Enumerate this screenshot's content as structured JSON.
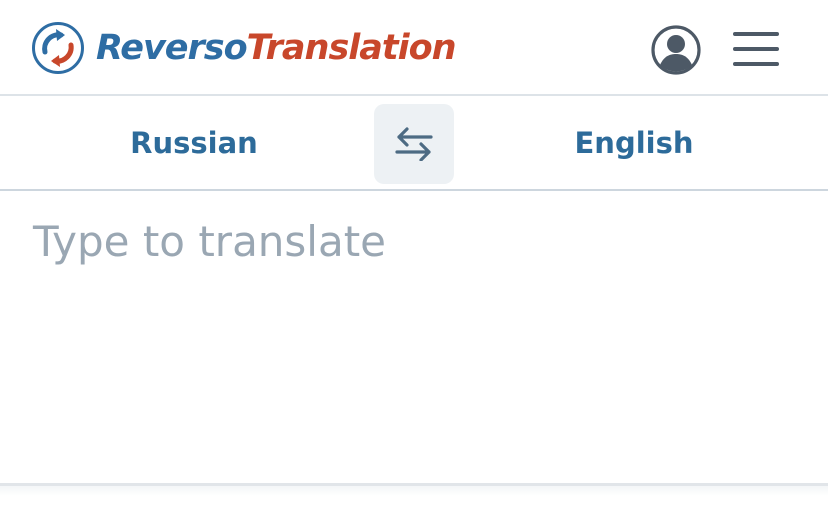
{
  "header": {
    "logo": {
      "brand_part1": "Reverso",
      "brand_part2": "Translation",
      "icon": "reverso-swap-logo-icon"
    },
    "account_icon": "user-account-icon",
    "menu_icon": "hamburger-menu-icon"
  },
  "language_bar": {
    "source_language": "Russian",
    "target_language": "English",
    "swap_icon": "swap-arrows-icon"
  },
  "input": {
    "value": "",
    "placeholder": "Type to translate"
  },
  "colors": {
    "brand_blue": "#2e6da4",
    "brand_red": "#c8472b",
    "language_text": "#2d6b9a",
    "placeholder": "#9aa7b3",
    "swap_bg": "#edf1f4",
    "icon_gray": "#4d5966"
  }
}
